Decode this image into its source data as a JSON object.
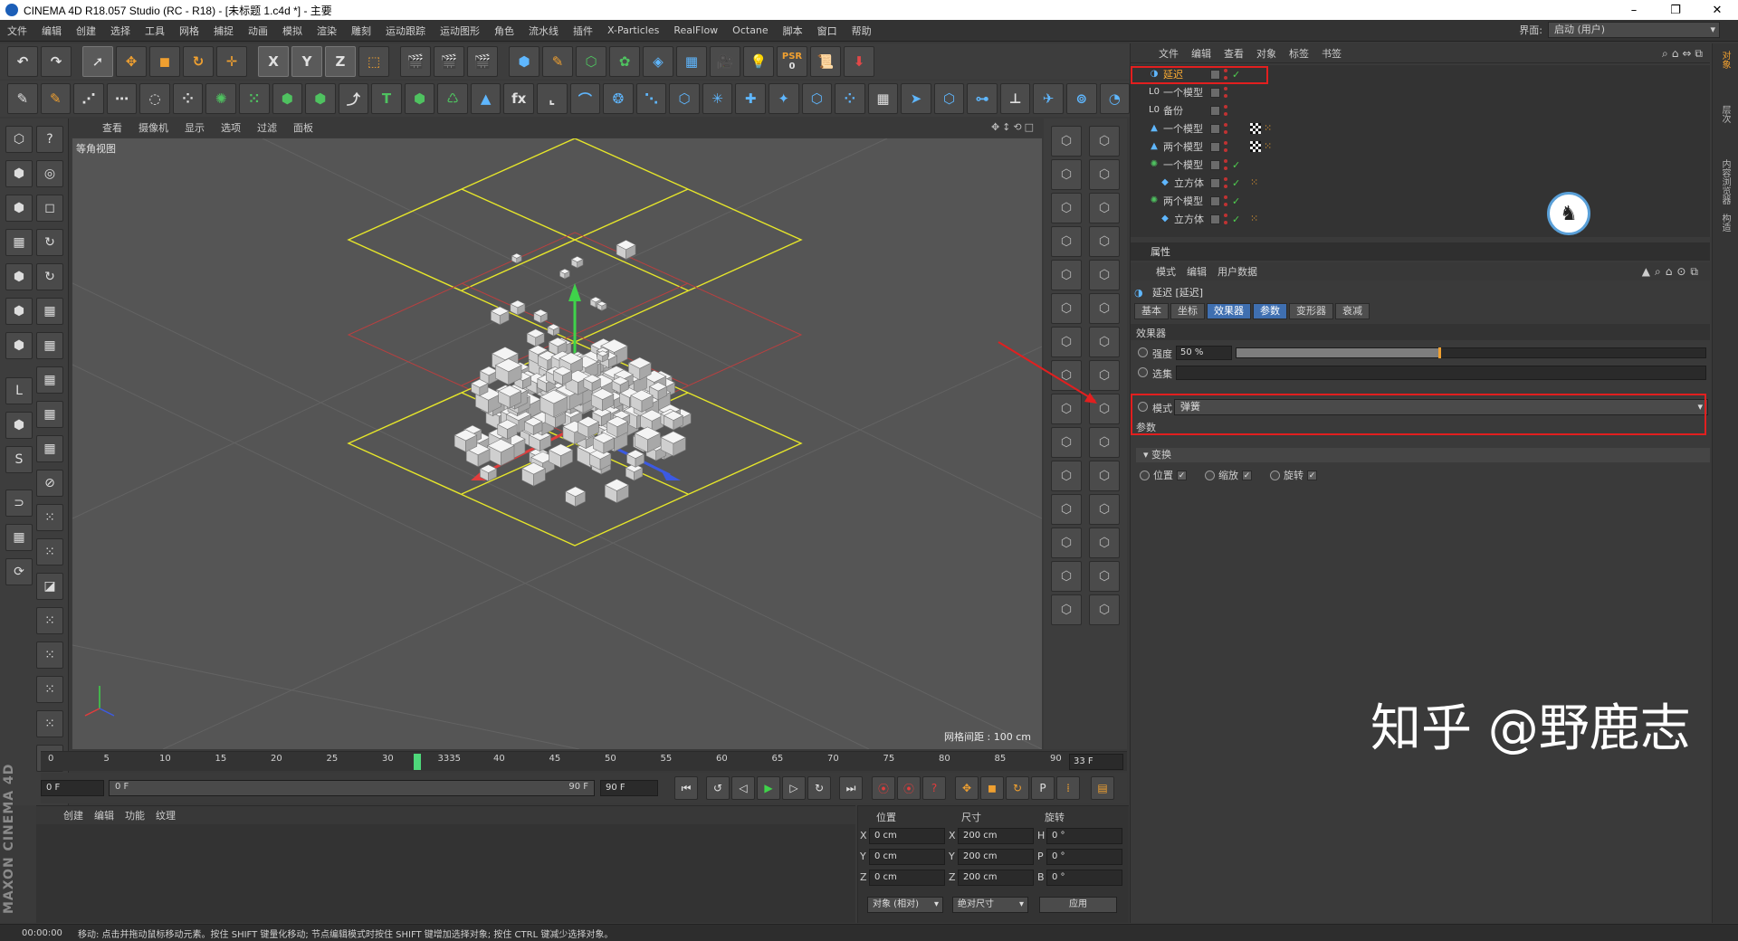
{
  "window": {
    "title": "CINEMA 4D R18.057 Studio (RC - R18) - [未标题 1.c4d *] - 主要",
    "minimize": "–",
    "maximize": "❐",
    "close": "✕"
  },
  "menubar": {
    "items": [
      "文件",
      "编辑",
      "创建",
      "选择",
      "工具",
      "网格",
      "捕捉",
      "动画",
      "模拟",
      "渲染",
      "雕刻",
      "运动跟踪",
      "运动图形",
      "角色",
      "流水线",
      "插件",
      "X-Particles",
      "RealFlow",
      "Octane",
      "脚本",
      "窗口",
      "帮助"
    ],
    "layout_label": "界面:",
    "layout_value": "启动 (用户)"
  },
  "toolbar": {
    "axis_x": "X",
    "axis_y": "Y",
    "axis_z": "Z",
    "psr_label": "PSR",
    "psr_value": "0"
  },
  "viewport": {
    "menu": [
      "查看",
      "摄像机",
      "显示",
      "选项",
      "过滤",
      "面板"
    ],
    "label": "等角视图",
    "grid_spacing": "网格间距 : 100 cm"
  },
  "object_manager": {
    "menu": [
      "文件",
      "编辑",
      "查看",
      "对象",
      "标签",
      "书签"
    ],
    "objects": [
      {
        "name": "延迟",
        "icon": "delay-effector-icon",
        "active": true,
        "has_checker": false,
        "has_orange": false
      },
      {
        "name": "一个模型",
        "icon": "null-icon",
        "active": false,
        "has_checker": false,
        "has_orange": false
      },
      {
        "name": "备份",
        "icon": "null-icon",
        "active": false,
        "has_checker": false,
        "has_orange": false
      },
      {
        "name": "一个模型",
        "icon": "matrix-icon",
        "active": false,
        "has_checker": true,
        "has_orange": true
      },
      {
        "name": "两个模型",
        "icon": "matrix-icon",
        "active": false,
        "has_checker": true,
        "has_orange": true
      },
      {
        "name": "一个模型",
        "icon": "cloner-icon",
        "active": false,
        "has_checker": false,
        "has_orange": false
      },
      {
        "name": "立方体",
        "icon": "cube-icon",
        "active": false,
        "has_checker": false,
        "has_orange": true
      },
      {
        "name": "两个模型",
        "icon": "cloner-icon",
        "active": false,
        "has_checker": false,
        "has_orange": false
      },
      {
        "name": "立方体",
        "icon": "cube-icon",
        "active": false,
        "has_checker": false,
        "has_orange": true
      }
    ]
  },
  "side_tabs": [
    "对象",
    "层次",
    "内容浏览器",
    "构造"
  ],
  "attributes": {
    "header": "属性",
    "menu": [
      "模式",
      "编辑",
      "用户数据"
    ],
    "object_name": "延迟 [延迟]",
    "tabs": [
      {
        "label": "基本",
        "active": false
      },
      {
        "label": "坐标",
        "active": false
      },
      {
        "label": "效果器",
        "active": true
      },
      {
        "label": "参数",
        "active": true
      },
      {
        "label": "变形器",
        "active": false
      },
      {
        "label": "衰减",
        "active": false
      }
    ],
    "effector_section": "效果器",
    "strength_label": "强度",
    "strength_value": "50 %",
    "strength_fraction": 0.43,
    "selection_label": "选集",
    "mode_label": "模式",
    "mode_value": "弹簧",
    "params_section": "参数",
    "transform_group": "▾ 变换",
    "position_label": "位置",
    "scale_label": "缩放",
    "rotation_label": "旋转",
    "check_mark": "✓"
  },
  "timeline": {
    "ticks": [
      "0",
      "5",
      "10",
      "15",
      "20",
      "25",
      "30",
      "3335",
      "40",
      "45",
      "50",
      "55",
      "60",
      "65",
      "70",
      "75",
      "80",
      "85",
      "90"
    ],
    "current_frame": "33 F",
    "start_field": "0 F",
    "range_start": "0 F",
    "range_end": "90 F",
    "end_field": "90 F"
  },
  "material_panel": {
    "menu": [
      "创建",
      "编辑",
      "功能",
      "纹理"
    ]
  },
  "coordinates": {
    "position_header": "位置",
    "size_header": "尺寸",
    "rotation_header": "旋转",
    "rows": [
      {
        "axis": "X",
        "pos": "0 cm",
        "size_axis": "X",
        "size": "200 cm",
        "rot_axis": "H",
        "rot": "0 °"
      },
      {
        "axis": "Y",
        "pos": "0 cm",
        "size_axis": "Y",
        "size": "200 cm",
        "rot_axis": "P",
        "rot": "0 °"
      },
      {
        "axis": "Z",
        "pos": "0 cm",
        "size_axis": "Z",
        "size": "200 cm",
        "rot_axis": "B",
        "rot": "0 °"
      }
    ],
    "mode_select": "对象 (相对)",
    "size_select": "绝对尺寸",
    "apply_button": "应用"
  },
  "branding": {
    "maxon": "MAXON CINEMA 4D",
    "watermark": "知乎 @野鹿志"
  },
  "statusbar": {
    "time": "00:00:00",
    "message": "移动: 点击并拖动鼠标移动元素。按住 SHIFT 键量化移动; 节点编辑模式时按住 SHIFT 键增加选择对象; 按住 CTRL 键减少选择对象。"
  },
  "colors": {
    "accent": "#f0a030",
    "highlight_red": "#e21f1f",
    "tab_active": "#3f6fb0",
    "grid_yellow": "#e6e62a"
  }
}
